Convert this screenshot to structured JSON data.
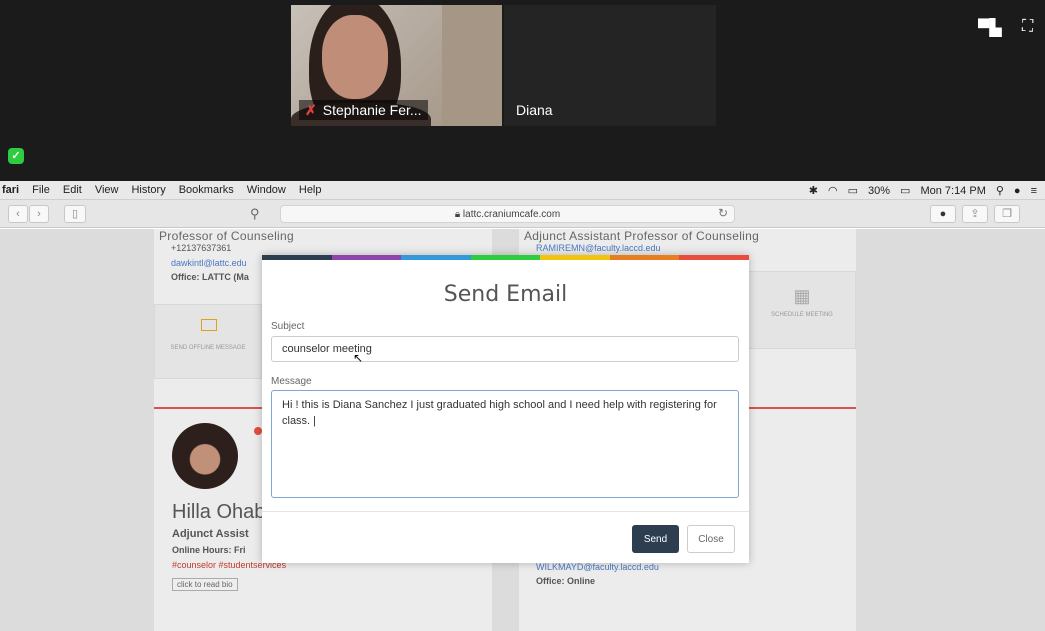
{
  "zoom": {
    "participant_me": "Stephanie Fer...",
    "participant_other": "Diana"
  },
  "menubar": {
    "items": [
      "fari",
      "File",
      "Edit",
      "View",
      "History",
      "Bookmarks",
      "Window",
      "Help"
    ],
    "battery": "30%",
    "clock": "Mon 7:14 PM"
  },
  "browser": {
    "url": "lattc.craniumcafe.com"
  },
  "cards": {
    "left_top": {
      "title": "Professor of Counseling",
      "phone": "+12137637361",
      "email": "dawkintl@lattc.edu",
      "office": "Office: LATTC (Ma",
      "action": "SEND OFFLINE MESSAGE"
    },
    "right_top": {
      "title": "Adjunct Assistant Professor of Counseling",
      "email": "RAMIREMN@faculty.laccd.edu",
      "action": "SCHEDULE MEETING"
    },
    "left_bottom": {
      "name": "Hilla Ohab",
      "title": "Adjunct Assist",
      "hours": "Online Hours: Fri",
      "tags": "#counselor #studentservices",
      "bio": "click to read bio"
    },
    "right_bottom": {
      "email": "WILKMAYD@faculty.laccd.edu",
      "office": "Office: Online"
    }
  },
  "modal": {
    "title": "Send Email",
    "subject_label": "Subject",
    "subject_value": "counselor meeting",
    "message_label": "Message",
    "message_value": "Hi ! this is Diana Sanchez I just graduated high school and I need help with registering for class. |",
    "send_label": "Send",
    "close_label": "Close",
    "accent_colors": [
      "#2c3e50",
      "#8e44ad",
      "#3498db",
      "#2ecc40",
      "#f1c40f",
      "#e67e22",
      "#e74c3c"
    ]
  }
}
